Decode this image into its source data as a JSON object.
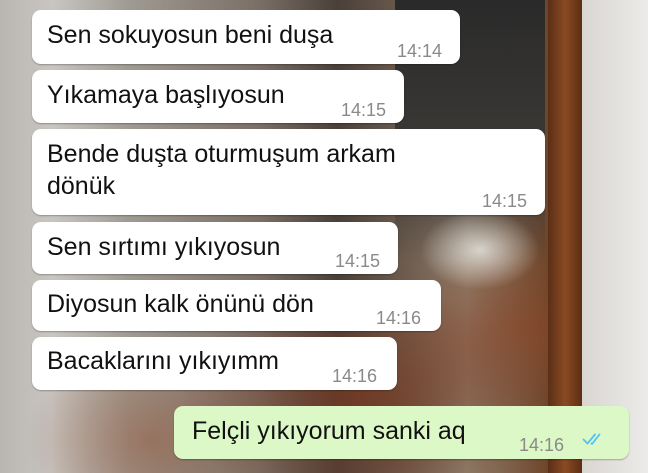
{
  "chat": {
    "messages": [
      {
        "text": "Sen sokuyosun beni duşa",
        "time": "14:14",
        "direction": "incoming"
      },
      {
        "text": "Yıkamaya başlıyosun",
        "time": "14:15",
        "direction": "incoming"
      },
      {
        "text_line1": "Bende duşta oturmuşum arkam",
        "text_line2": "dönük",
        "time": "14:15",
        "direction": "incoming"
      },
      {
        "text": "Sen sırtımı yıkıyosun",
        "time": "14:15",
        "direction": "incoming"
      },
      {
        "text": "Diyosun kalk önünü dön",
        "time": "14:16",
        "direction": "incoming"
      },
      {
        "text": "Bacaklarını yıkıyımm",
        "time": "14:16",
        "direction": "incoming"
      },
      {
        "text": "Felçli yıkıyorum sanki aq",
        "time": "14:16",
        "direction": "outgoing",
        "status": "read"
      }
    ],
    "colors": {
      "incoming_bubble": "#ffffff",
      "outgoing_bubble": "#dcf8c6",
      "read_ticks": "#4fc3f7",
      "timestamp": "#8a8a8a"
    },
    "icons": {
      "read_receipt": "double-check-icon"
    }
  }
}
